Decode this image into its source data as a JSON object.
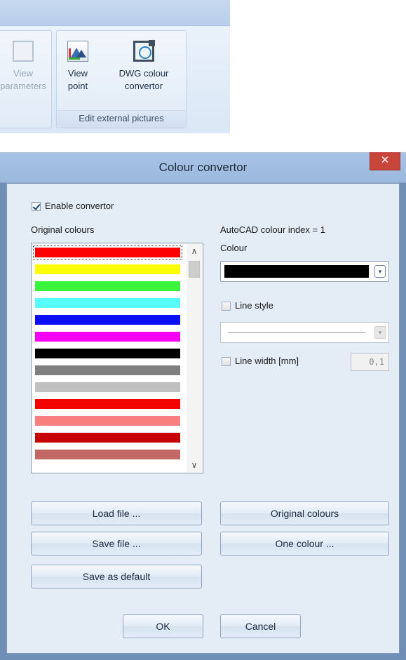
{
  "ribbon": {
    "partial_button": {
      "line1": "View",
      "line2": "parameters"
    },
    "view_point_button": {
      "line1": "View",
      "line2": "point"
    },
    "dwg_button": {
      "line1": "DWG colour",
      "line2": "convertor"
    },
    "group_title": "Edit external pictures",
    "icons": [
      "parameters-icon",
      "view-point-icon",
      "dwg-colour-convertor-icon"
    ]
  },
  "dialog": {
    "title": "Colour convertor",
    "close_label": "✕",
    "enable_label": "Enable convertor",
    "enable_checked": true,
    "original_colours_label": "Original colours",
    "aci_label": "AutoCAD colour index = 1",
    "colour_label": "Colour",
    "selected_colour": "#000000",
    "line_style_label": "Line style",
    "line_style_checked": false,
    "line_width_label": "Line width [mm]",
    "line_width_checked": false,
    "line_width_value": "0,1",
    "swatches": [
      "#ff0000",
      "#ffff00",
      "#39f53a",
      "#55ffff",
      "#0a0ff5",
      "#f500f5",
      "#000000",
      "#7f7f7f",
      "#c0c0c0",
      "#f50000",
      "#fb7f7f",
      "#c60000",
      "#c46866"
    ],
    "buttons": {
      "load_file": "Load file ...",
      "save_file": "Save file ...",
      "save_default": "Save as default",
      "original_colours": "Original colours",
      "one_colour": "One colour ...",
      "ok": "OK",
      "cancel": "Cancel"
    }
  }
}
